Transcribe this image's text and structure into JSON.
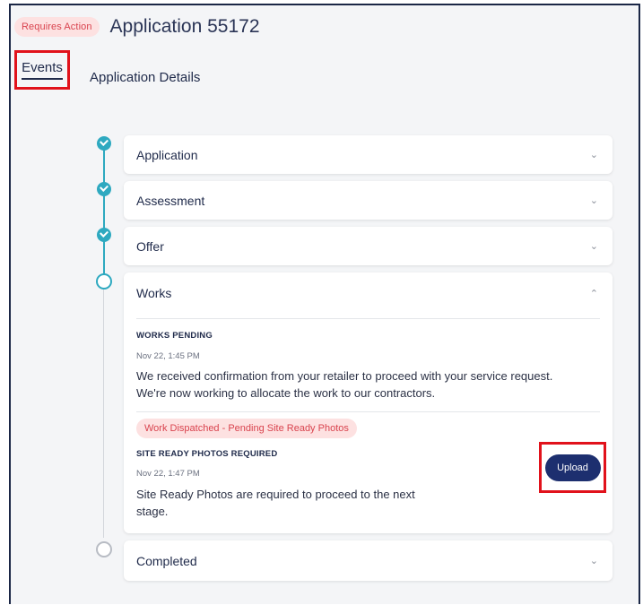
{
  "header": {
    "badge": "Requires Action",
    "title": "Application 55172"
  },
  "tabs": [
    {
      "label": "Events",
      "active": true
    },
    {
      "label": "Application Details",
      "active": false
    }
  ],
  "timeline": {
    "stages": [
      {
        "label": "Application",
        "status": "done",
        "chevron": "chevron-down"
      },
      {
        "label": "Assessment",
        "status": "done",
        "chevron": "chevron-down"
      },
      {
        "label": "Offer",
        "status": "done",
        "chevron": "chevron-down"
      },
      {
        "label": "Works",
        "status": "current",
        "chevron": "chevron-up"
      },
      {
        "label": "Completed",
        "status": "pending",
        "chevron": "chevron-down"
      }
    ],
    "works_events": [
      {
        "heading": "WORKS PENDING",
        "time": "Nov 22, 1:45 PM",
        "text_lines": [
          "We received confirmation from your retailer to proceed with your service request.",
          "We're now working to allocate the work to our contractors."
        ]
      },
      {
        "status_chip": "Work Dispatched - Pending Site Ready Photos",
        "heading": "SITE READY PHOTOS REQUIRED",
        "time": "Nov 22, 1:47 PM",
        "text_lines": [
          "Site Ready Photos are required to proceed to the next",
          "stage."
        ],
        "action_label": "Upload"
      }
    ]
  },
  "colors": {
    "accent_teal": "#2ea9c0",
    "navy": "#1d2f6f",
    "alert_red": "#d9434e",
    "highlight_red": "#e1121b"
  }
}
